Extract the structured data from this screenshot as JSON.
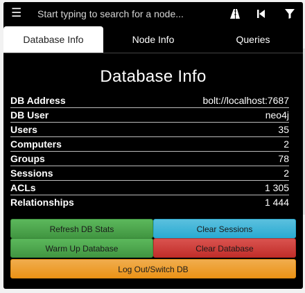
{
  "search": {
    "menu_icon": "☰",
    "placeholder": "Start typing to search for a node..."
  },
  "toolbar_icons": [
    "pathfinding-icon",
    "back-icon",
    "filter-icon"
  ],
  "tabs": [
    {
      "label": "Database Info",
      "active": true
    },
    {
      "label": "Node Info",
      "active": false
    },
    {
      "label": "Queries",
      "active": false
    }
  ],
  "db_info": {
    "title": "Database Info",
    "rows": [
      {
        "label": "DB Address",
        "value": "bolt://localhost:7687"
      },
      {
        "label": "DB User",
        "value": "neo4j"
      },
      {
        "label": "Users",
        "value": "35"
      },
      {
        "label": "Computers",
        "value": "2"
      },
      {
        "label": "Groups",
        "value": "78"
      },
      {
        "label": "Sessions",
        "value": "2"
      },
      {
        "label": "ACLs",
        "value": "1 305"
      },
      {
        "label": "Relationships",
        "value": "1 444"
      }
    ]
  },
  "buttons": {
    "refresh": "Refresh DB Stats",
    "clear_sessions": "Clear Sessions",
    "warm_up": "Warm Up Database",
    "clear_database": "Clear Database",
    "logout": "Log Out/Switch DB"
  },
  "colors": {
    "success": "#5cb85c",
    "info": "#5bc0de",
    "danger": "#d9534f",
    "warning": "#f0ad4e",
    "panel_background": "#000000"
  }
}
